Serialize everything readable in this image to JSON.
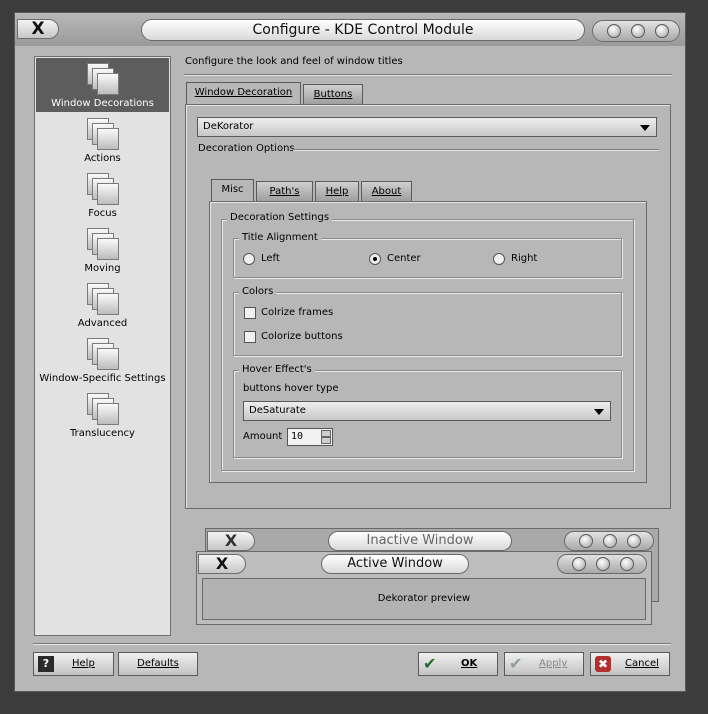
{
  "window": {
    "title": "Configure - KDE Control Module",
    "close_glyph": "X"
  },
  "sidebar": {
    "items": [
      {
        "label": "Window Decorations",
        "selected": true
      },
      {
        "label": "Actions"
      },
      {
        "label": "Focus"
      },
      {
        "label": "Moving"
      },
      {
        "label": "Advanced"
      },
      {
        "label": "Window-Specific Settings"
      },
      {
        "label": "Translucency"
      }
    ]
  },
  "header": {
    "text": "Configure the look and feel of window titles"
  },
  "tabs": [
    {
      "label": "Window Decoration",
      "active": true
    },
    {
      "label": "Buttons"
    }
  ],
  "decoration_combo": {
    "value": "DeKorator"
  },
  "decoration_options_label": "Decoration Options",
  "inner_tabs": [
    {
      "label": "Misc",
      "active": true
    },
    {
      "label": "Path's"
    },
    {
      "label": "Help"
    },
    {
      "label": "About"
    }
  ],
  "decoration_settings": {
    "label": "Decoration Settings",
    "title_alignment": {
      "label": "Title Alignment",
      "options": [
        {
          "label": "Left"
        },
        {
          "label": "Center",
          "checked": true
        },
        {
          "label": "Right"
        }
      ]
    },
    "colors": {
      "label": "Colors",
      "colorize_frames": "Colrize frames",
      "colorize_buttons": "Colorize buttons"
    },
    "hover": {
      "label": "Hover Effect's",
      "type_label": "buttons hover type",
      "type_value": "DeSaturate",
      "amount_label": "Amount",
      "amount_value": "10"
    }
  },
  "preview": {
    "inactive_title": "Inactive Window",
    "active_title": "Active Window",
    "body_text": "Dekorator preview"
  },
  "buttons": {
    "help": "Help",
    "defaults": "Defaults",
    "ok": "OK",
    "apply": "Apply",
    "cancel": "Cancel"
  },
  "colors": {
    "background": "#3c3c3c",
    "window": "#b7b7b7",
    "selection": "#5d5d5d"
  }
}
